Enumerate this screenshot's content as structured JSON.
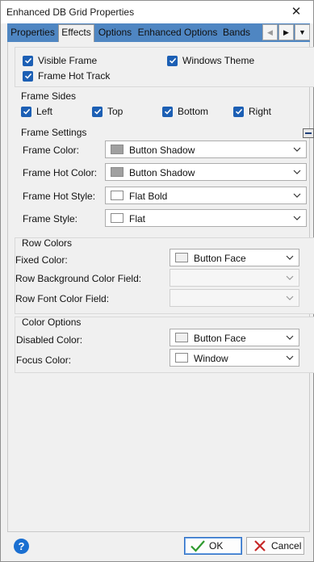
{
  "window": {
    "title": "Enhanced DB Grid Properties",
    "close_glyph": "✕"
  },
  "tabs": [
    {
      "label": "Properties",
      "active": false
    },
    {
      "label": "Effects",
      "active": true
    },
    {
      "label": "Options",
      "active": false
    },
    {
      "label": "Enhanced Options",
      "active": false
    },
    {
      "label": "Bands",
      "active": false
    }
  ],
  "tab_arrows": {
    "left": "◀",
    "right": "▶",
    "menu": "▼"
  },
  "frame_checks": {
    "visible_frame": {
      "label": "Visible Frame",
      "checked": true
    },
    "windows_theme": {
      "label": "Windows Theme",
      "checked": true
    },
    "frame_hot_track": {
      "label": "Frame Hot Track",
      "checked": true
    }
  },
  "frame_sides": {
    "title": "Frame Sides",
    "left": {
      "label": "Left",
      "checked": true
    },
    "top": {
      "label": "Top",
      "checked": true
    },
    "bottom": {
      "label": "Bottom",
      "checked": true
    },
    "right": {
      "label": "Right",
      "checked": true
    }
  },
  "frame_settings": {
    "title": "Frame Settings",
    "frame_color": {
      "label": "Frame Color:",
      "value": "Button Shadow",
      "swatch": "#a0a0a0"
    },
    "frame_hot_color": {
      "label": "Frame Hot Color:",
      "value": "Button Shadow",
      "swatch": "#a0a0a0"
    },
    "frame_hot_style": {
      "label": "Frame Hot Style:",
      "value": "Flat Bold",
      "swatch": "#ffffff"
    },
    "frame_style": {
      "label": "Frame Style:",
      "value": "Flat",
      "swatch": "#ffffff"
    }
  },
  "row_colors": {
    "title": "Row Colors",
    "fixed_color": {
      "label": "Fixed Color:",
      "value": "Button Face",
      "swatch": "#f0f0f0"
    },
    "row_bg_field": {
      "label": "Row Background Color Field:",
      "value": ""
    },
    "row_font_field": {
      "label": "Row Font Color Field:",
      "value": ""
    }
  },
  "color_options": {
    "title": "Color Options",
    "disabled_color": {
      "label": "Disabled Color:",
      "value": "Button Face",
      "swatch": "#f0f0f0"
    },
    "focus_color": {
      "label": "Focus Color:",
      "value": "Window",
      "swatch": "#ffffff"
    }
  },
  "buttons": {
    "help": "?",
    "ok": "OK",
    "cancel": "Cancel"
  },
  "colors": {
    "accent": "#1c5fb4",
    "tab_strip": "#4f86c2",
    "help": "#1a6fd1"
  }
}
